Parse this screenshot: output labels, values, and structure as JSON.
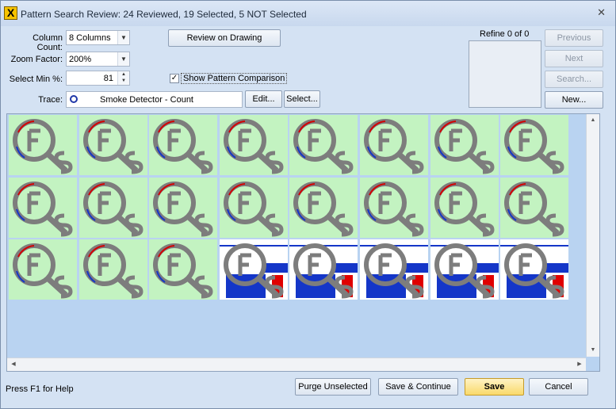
{
  "window": {
    "title": "Pattern Search Review: 24 Reviewed, 19 Selected, 5 NOT Selected"
  },
  "controls": {
    "column_count_label": "Column Count:",
    "column_count_value": "8 Columns",
    "zoom_label": "Zoom Factor:",
    "zoom_value": "200%",
    "select_min_label": "Select Min %:",
    "select_min_value": "81",
    "review_button": "Review on Drawing",
    "show_comparison_label": "Show Pattern Comparison",
    "trace_label": "Trace:",
    "trace_value": "Smoke Detector - Count",
    "edit_button": "Edit...",
    "select_button": "Select..."
  },
  "refine": {
    "label": "Refine 0 of 0",
    "previous": "Previous",
    "next": "Next",
    "search": "Search...",
    "new": "New..."
  },
  "status": {
    "help": "Press F1 for Help"
  },
  "footer": {
    "purge": "Purge Unselected",
    "save_continue": "Save & Continue",
    "save": "Save",
    "cancel": "Cancel"
  },
  "tiles": [
    {
      "selected": true
    },
    {
      "selected": true
    },
    {
      "selected": true
    },
    {
      "selected": true
    },
    {
      "selected": true
    },
    {
      "selected": true
    },
    {
      "selected": true
    },
    {
      "selected": true
    },
    {
      "selected": true
    },
    {
      "selected": true
    },
    {
      "selected": true
    },
    {
      "selected": true
    },
    {
      "selected": true
    },
    {
      "selected": true
    },
    {
      "selected": true
    },
    {
      "selected": true
    },
    {
      "selected": true
    },
    {
      "selected": true
    },
    {
      "selected": true
    },
    {
      "selected": false
    },
    {
      "selected": false
    },
    {
      "selected": false
    },
    {
      "selected": false
    },
    {
      "selected": false
    }
  ],
  "colors": {
    "selected_bg": "#c3f3c1",
    "not_selected_bg": "#ffffff",
    "accent": "#f9d96b"
  }
}
